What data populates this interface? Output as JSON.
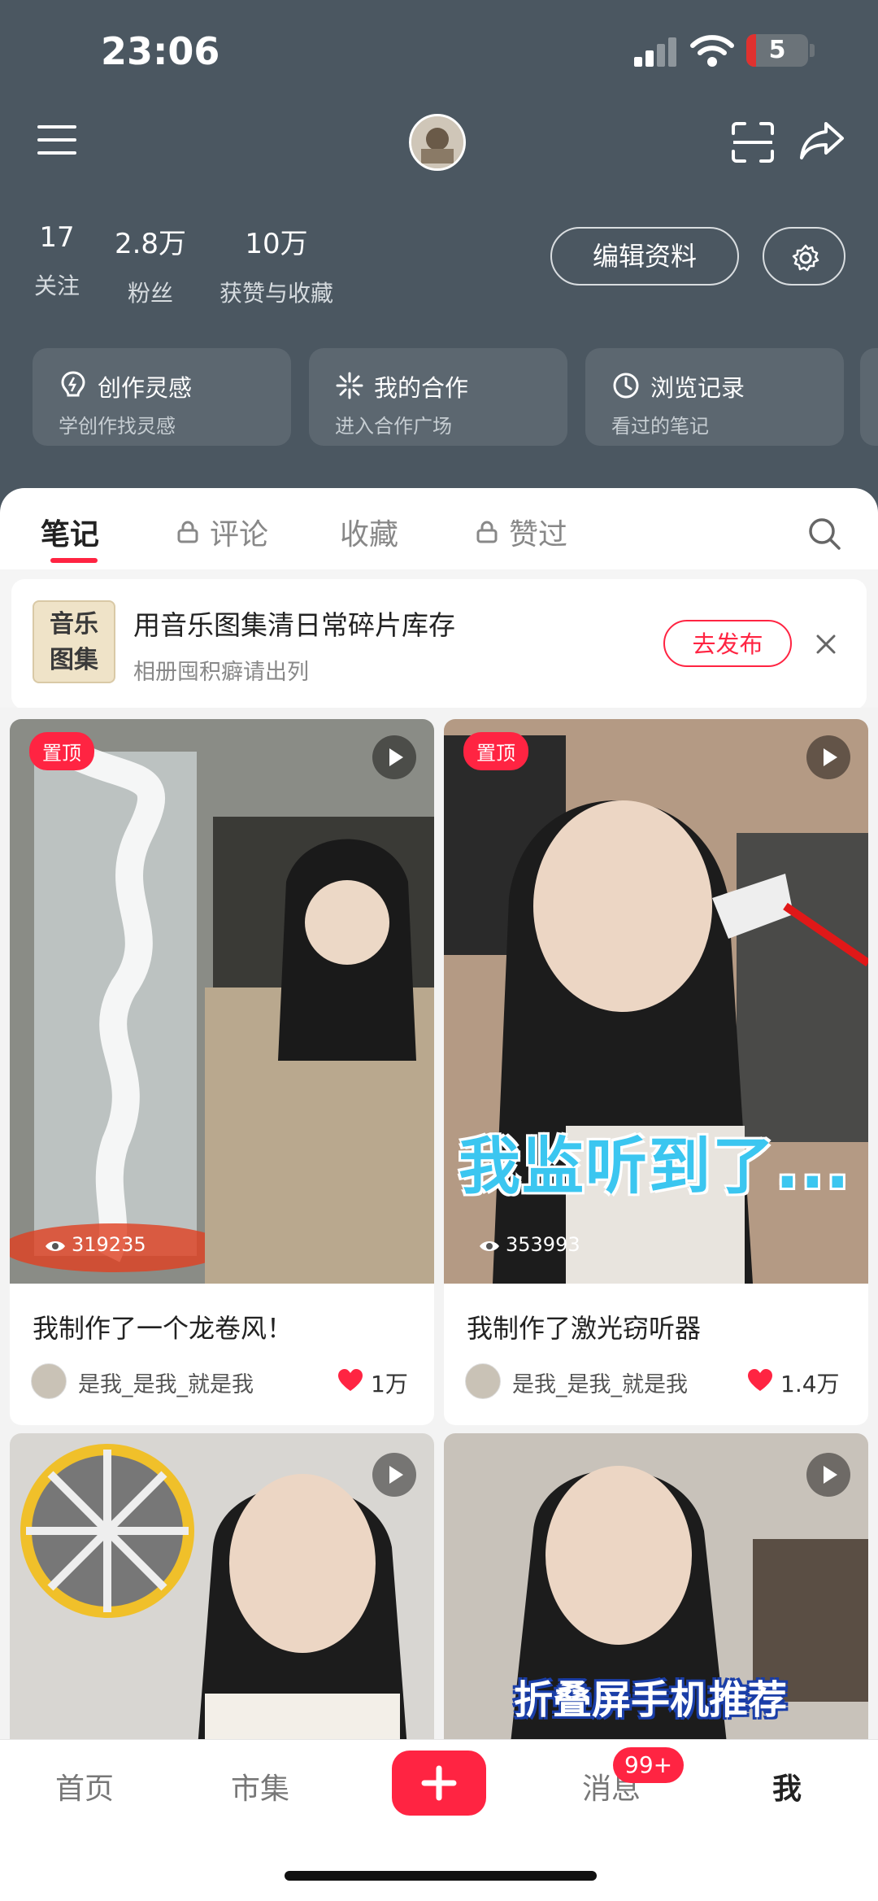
{
  "status_bar": {
    "time": "23:06",
    "battery": "5"
  },
  "profile": {
    "stats": [
      {
        "value": "17",
        "label": "关注"
      },
      {
        "value": "2.8万",
        "label": "粉丝"
      },
      {
        "value": "10万",
        "label": "获赞与收藏"
      }
    ],
    "edit_label": "编辑资料"
  },
  "cards": [
    {
      "title": "创作灵感",
      "subtitle": "学创作找灵感",
      "icon": "lightbulb-icon"
    },
    {
      "title": "我的合作",
      "subtitle": "进入合作广场",
      "icon": "sparkle-icon"
    },
    {
      "title": "浏览记录",
      "subtitle": "看过的笔记",
      "icon": "clock-icon"
    }
  ],
  "tabs": [
    {
      "label": "笔记",
      "locked": false,
      "active": true
    },
    {
      "label": "评论",
      "locked": true,
      "active": false
    },
    {
      "label": "收藏",
      "locked": false,
      "active": false
    },
    {
      "label": "赞过",
      "locked": true,
      "active": false
    }
  ],
  "promo": {
    "thumb_text": "音乐图集",
    "title": "用音乐图集清日常碎片库存",
    "subtitle": "相册囤积癖请出列",
    "action": "去发布"
  },
  "notes": [
    {
      "pin": "置顶",
      "views": "319235",
      "title": "我制作了一个龙卷风！",
      "author": "是我_是我_就是我",
      "likes": "1万"
    },
    {
      "pin": "置顶",
      "views": "353993",
      "title": "我制作了激光窃听器",
      "author": "是我_是我_就是我",
      "likes": "1.4万",
      "overlay": "我监听到了..."
    },
    {
      "overlay": ""
    },
    {
      "overlay": "折叠屏手机推荐"
    }
  ],
  "bottom_nav": [
    {
      "label": "首页",
      "active": false
    },
    {
      "label": "市集",
      "active": false
    },
    {
      "label": "消息",
      "active": false
    },
    {
      "label": "我",
      "active": true
    }
  ],
  "badge": "99+",
  "colors": {
    "accent": "#ff2442",
    "header_bg": "#4b5761"
  }
}
